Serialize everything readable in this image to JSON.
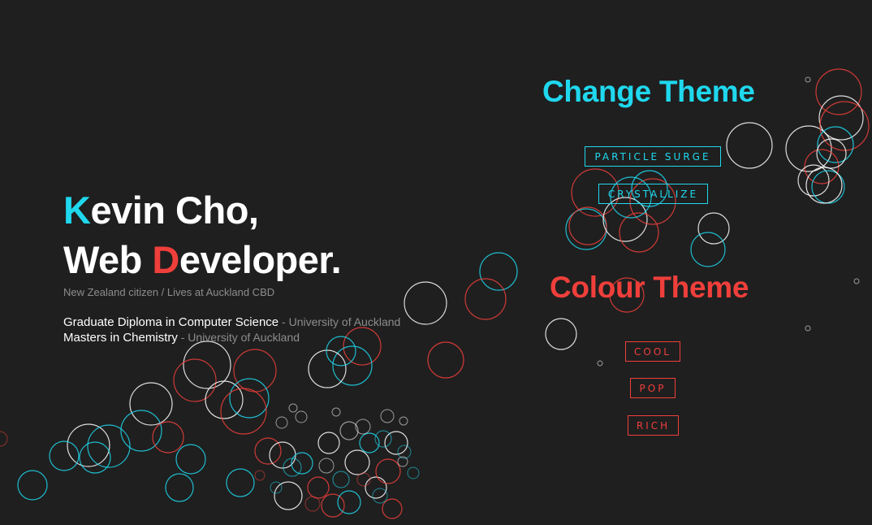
{
  "hero": {
    "line1_initial": "K",
    "line1_rest": "evin Cho,",
    "line2_start": "Web ",
    "line2_initial": "D",
    "line2_rest": "eveloper.",
    "subtitle": "New Zealand citizen / Lives at Auckland CBD",
    "education": [
      {
        "degree": "Graduate Diploma in Computer Science",
        "institution": " - University of Auckland"
      },
      {
        "degree": "Masters in Chemistry",
        "institution": " - University of Auckland"
      }
    ]
  },
  "change_theme": {
    "heading": "Change Theme",
    "buttons": [
      "PARTICLE SURGE",
      "CRYSTALLIZE"
    ]
  },
  "colour_theme": {
    "heading": "Colour Theme",
    "buttons": [
      "COOL",
      "POP",
      "RICH"
    ]
  },
  "colors": {
    "background": "#1f1f1f",
    "cyan": "#1fd8ee",
    "red": "#ef3f3b",
    "white": "#ffffff",
    "muted": "#8d8d8d"
  }
}
